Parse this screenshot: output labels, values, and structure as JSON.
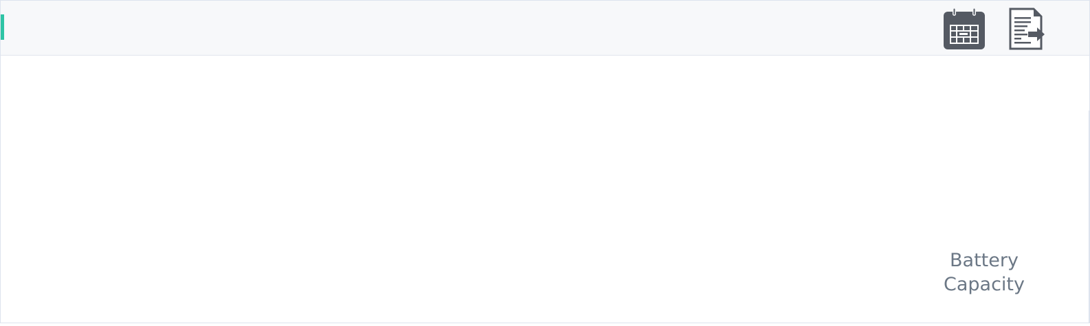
{
  "toolbar": {
    "accent_color": "#2ec4a5",
    "buttons": [
      {
        "icon": "calendar-icon",
        "label": ""
      },
      {
        "icon": "export-report-icon",
        "label": ""
      }
    ]
  },
  "main": {
    "battery_label": "Battery\nCapacity"
  },
  "colors": {
    "icon": "#555a63",
    "label": "#6b7785",
    "toolbar_bg": "#f7f8fa",
    "border": "#dde3ee"
  }
}
